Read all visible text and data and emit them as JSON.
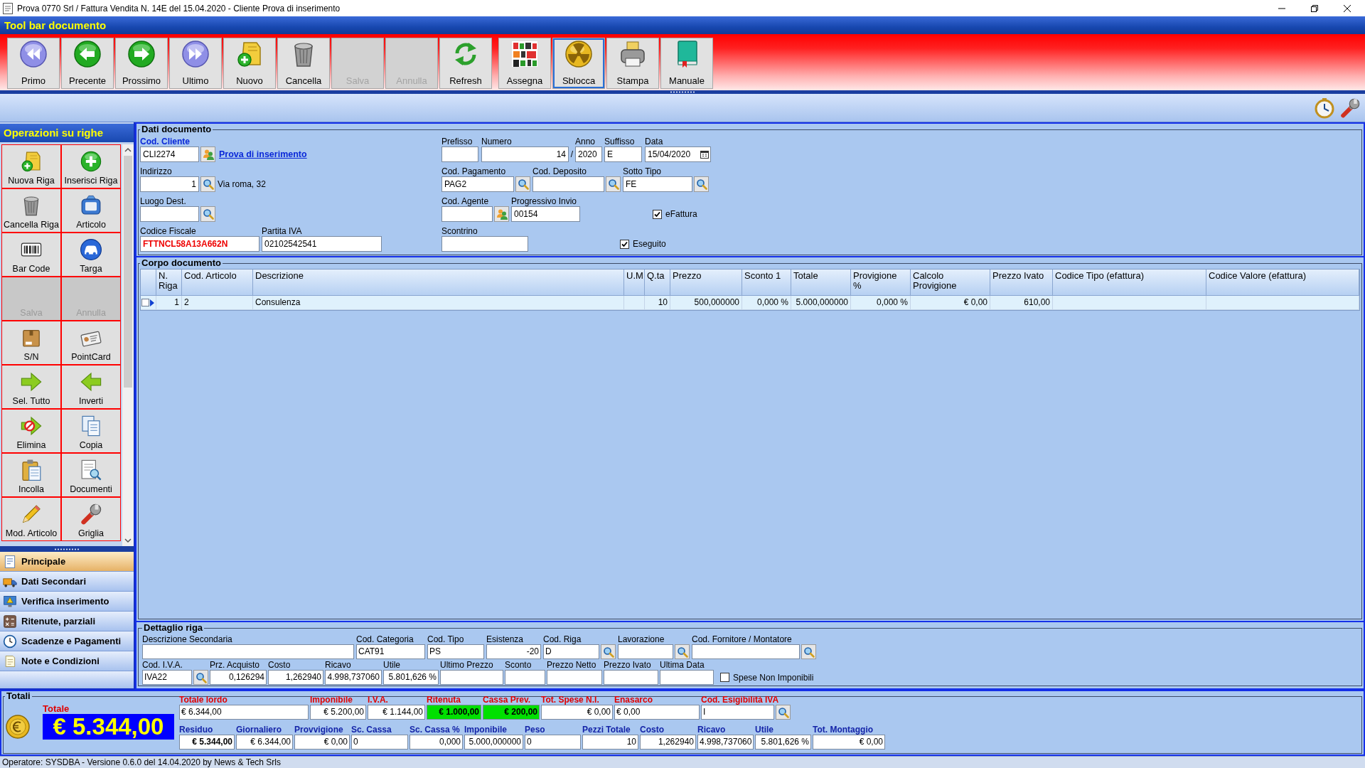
{
  "window": {
    "title": "Prova 0770 Srl / Fattura Vendita N. 14E del 15.04.2020 - Cliente Prova di inserimento"
  },
  "toolbar": {
    "title": "Tool bar documento",
    "buttons": [
      {
        "label": "Primo",
        "disabled": false,
        "focused": false
      },
      {
        "label": "Precente",
        "disabled": false,
        "focused": false
      },
      {
        "label": "Prossimo",
        "disabled": false,
        "focused": false
      },
      {
        "label": "Ultimo",
        "disabled": false,
        "focused": false
      },
      {
        "label": "Nuovo",
        "disabled": false,
        "focused": false
      },
      {
        "label": "Cancella",
        "disabled": false,
        "focused": false
      },
      {
        "label": "Salva",
        "disabled": true,
        "focused": false
      },
      {
        "label": "Annulla",
        "disabled": true,
        "focused": false
      },
      {
        "label": "Refresh",
        "disabled": false,
        "focused": false
      },
      {
        "label": "Assegna",
        "disabled": false,
        "focused": false
      },
      {
        "label": "Sblocca",
        "disabled": false,
        "focused": true
      },
      {
        "label": "Stampa",
        "disabled": false,
        "focused": false
      },
      {
        "label": "Manuale",
        "disabled": false,
        "focused": false
      }
    ]
  },
  "sidebar": {
    "title": "Operazioni su righe",
    "buttons": [
      {
        "label": "Nuova Riga",
        "disabled": false
      },
      {
        "label": "Inserisci Riga",
        "disabled": false
      },
      {
        "label": "Cancella Riga",
        "disabled": false
      },
      {
        "label": "Articolo",
        "disabled": false
      },
      {
        "label": "Bar Code",
        "disabled": false
      },
      {
        "label": "Targa",
        "disabled": false
      },
      {
        "label": "Salva",
        "disabled": true
      },
      {
        "label": "Annulla",
        "disabled": true
      },
      {
        "label": "S/N",
        "disabled": false
      },
      {
        "label": "PointCard",
        "disabled": false
      },
      {
        "label": "Sel. Tutto",
        "disabled": false
      },
      {
        "label": "Inverti",
        "disabled": false
      },
      {
        "label": "Elimina",
        "disabled": false
      },
      {
        "label": "Copia",
        "disabled": false
      },
      {
        "label": "Incolla",
        "disabled": false
      },
      {
        "label": "Documenti",
        "disabled": false
      },
      {
        "label": "Mod. Articolo",
        "disabled": false
      },
      {
        "label": "Griglia",
        "disabled": false
      }
    ],
    "nav_items": [
      {
        "label": "Principale",
        "selected": true
      },
      {
        "label": "Dati Secondari",
        "selected": false
      },
      {
        "label": "Verifica inserimento",
        "selected": false
      },
      {
        "label": "Ritenute, parziali",
        "selected": false
      },
      {
        "label": "Scadenze e Pagamenti",
        "selected": false
      },
      {
        "label": "Note e Condizioni",
        "selected": false
      }
    ]
  },
  "dati_documento": {
    "title": "Dati documento",
    "cod_cliente": {
      "label": "Cod. Cliente",
      "value": "CLI2274"
    },
    "cliente_link": "Prova di inserimento",
    "indirizzo": {
      "label": "Indirizzo",
      "value": "1"
    },
    "indirizzo_testo": "Via roma, 32",
    "luogo_dest": {
      "label": "Luogo Dest."
    },
    "codice_fiscale": {
      "label": "Codice Fiscale",
      "value": "FTTNCL58A13A662N"
    },
    "partita_iva": {
      "label": "Partita IVA",
      "value": "02102542541"
    },
    "prefisso": {
      "label": "Prefisso"
    },
    "numero": {
      "label": "Numero",
      "value": "14"
    },
    "separatore": "/",
    "anno": {
      "label": "Anno",
      "value": "2020"
    },
    "suffisso": {
      "label": "Suffisso",
      "value": "E"
    },
    "data": {
      "label": "Data",
      "value": "15/04/2020"
    },
    "cod_pagamento": {
      "label": "Cod. Pagamento",
      "value": "PAG2"
    },
    "cod_deposito": {
      "label": "Cod. Deposito"
    },
    "sotto_tipo": {
      "label": "Sotto Tipo",
      "value": "FE"
    },
    "cod_agente": {
      "label": "Cod. Agente"
    },
    "progressivo_invio": {
      "label": "Progressivo Invio",
      "value": "00154"
    },
    "efattura": {
      "label": "eFattura",
      "checked": true
    },
    "scontrino": {
      "label": "Scontrino"
    },
    "eseguito": {
      "label": "Eseguito",
      "checked": true
    }
  },
  "corpo_documento": {
    "title": "Corpo documento",
    "columns": [
      "N. Riga",
      "Cod. Articolo",
      "Descrizione",
      "U.M",
      "Q.ta",
      "Prezzo",
      "Sconto 1",
      "Totale",
      "Provigione %",
      "Calcolo Provigione",
      "Prezzo Ivato",
      "Codice Tipo (efattura)",
      "Codice Valore (efattura)"
    ],
    "rows": [
      {
        "selected": true,
        "checked": false,
        "cells": [
          "1",
          "2",
          "Consulenza",
          null,
          "10",
          "500,000000",
          "0,000 %",
          "5.000,000000",
          "0,000 %",
          "€ 0,00",
          "610,00",
          null,
          null
        ]
      }
    ]
  },
  "dettaglio_riga": {
    "title": "Dettaglio riga",
    "row_1": [
      {
        "label": "Descrizione Secondaria",
        "lookup": false
      },
      {
        "label": "Cod. Categoria",
        "value": "CAT91",
        "lookup": false
      },
      {
        "label": "Cod. Tipo",
        "value": "PS",
        "lookup": false
      },
      {
        "label": "Esistenza",
        "value": "-20",
        "lookup": false
      },
      {
        "label": "Cod. Riga",
        "value": "D",
        "lookup": true
      },
      {
        "label": "Lavorazione",
        "lookup": true
      },
      {
        "label": "Cod. Fornitore / Montatore",
        "lookup": true
      }
    ],
    "row_2": [
      {
        "label": "Cod. I.V.A.",
        "value": "IVA22",
        "lookup": true
      },
      {
        "label": "Prz. Acquisto",
        "value": "0,126294",
        "lookup": false
      },
      {
        "label": "Costo",
        "value": "1,262940",
        "lookup": false
      },
      {
        "label": "Ricavo",
        "value": "4.998,737060",
        "lookup": false
      },
      {
        "label": "Utile",
        "value": "5.801,626 %",
        "lookup": false
      },
      {
        "label": "Ultimo Prezzo",
        "lookup": false
      },
      {
        "label": "Sconto",
        "lookup": false
      },
      {
        "label": "Prezzo Netto",
        "lookup": false
      },
      {
        "label": "Prezzo Ivato",
        "lookup": false
      },
      {
        "label": "Ultima Data",
        "lookup": false
      }
    ],
    "spese_non_imponibili": {
      "label": "Spese Non Imponibili",
      "checked": false
    }
  },
  "totali": {
    "title": "Totali",
    "totale": {
      "label": "Totale",
      "value": "€ 5.344,00"
    },
    "row_1": [
      {
        "label": "Totale lordo",
        "value": "€ 6.344,00",
        "highlighted": false,
        "lookup": false
      },
      {
        "label": "Imponibile",
        "value": "€ 5.200,00",
        "highlighted": false,
        "lookup": false
      },
      {
        "label": "I.V.A.",
        "value": "€ 1.144,00",
        "highlighted": false,
        "lookup": false
      },
      {
        "label": "Ritenuta",
        "value": "€ 1.000,00",
        "highlighted": true,
        "lookup": false
      },
      {
        "label": "Cassa Prev.",
        "value": "€ 200,00",
        "highlighted": true,
        "lookup": false
      },
      {
        "label": "Tot. Spese N.I.",
        "value": "€ 0,00",
        "highlighted": false,
        "lookup": false
      },
      {
        "label": "Enasarco",
        "value": "€ 0,00",
        "highlighted": false,
        "lookup": false
      },
      {
        "label": "Cod. Esigibilità IVA",
        "value": "I",
        "highlighted": false,
        "lookup": true
      }
    ],
    "row_2": [
      {
        "label": "Residuo",
        "value": "€ 5.344,00",
        "bold": true
      },
      {
        "label": "Giornaliero",
        "value": "€ 6.344,00",
        "bold": false
      },
      {
        "label": "Provvigione",
        "value": "€ 0,00",
        "bold": false
      },
      {
        "label": "Sc. Cassa",
        "value": "0",
        "bold": false
      },
      {
        "label": "Sc. Cassa %",
        "value": "0,000",
        "bold": false
      },
      {
        "label": "Imponibile",
        "value": "5.000,000000",
        "bold": false
      },
      {
        "label": "Peso",
        "value": "0",
        "bold": false
      },
      {
        "label": "Pezzi Totale",
        "value": "10",
        "bold": false
      },
      {
        "label": "Costo",
        "value": "1,262940",
        "bold": false
      },
      {
        "label": "Ricavo",
        "value": "4.998,737060",
        "bold": false
      },
      {
        "label": "Utile",
        "value": "5.801,626 %",
        "bold": false
      },
      {
        "label": "Tot. Montaggio",
        "value": "€ 0,00",
        "bold": false
      }
    ]
  },
  "status_bar": "Operatore: SYSDBA - Versione 0.6.0 del 14.04.2020 by News & Tech Srls"
}
